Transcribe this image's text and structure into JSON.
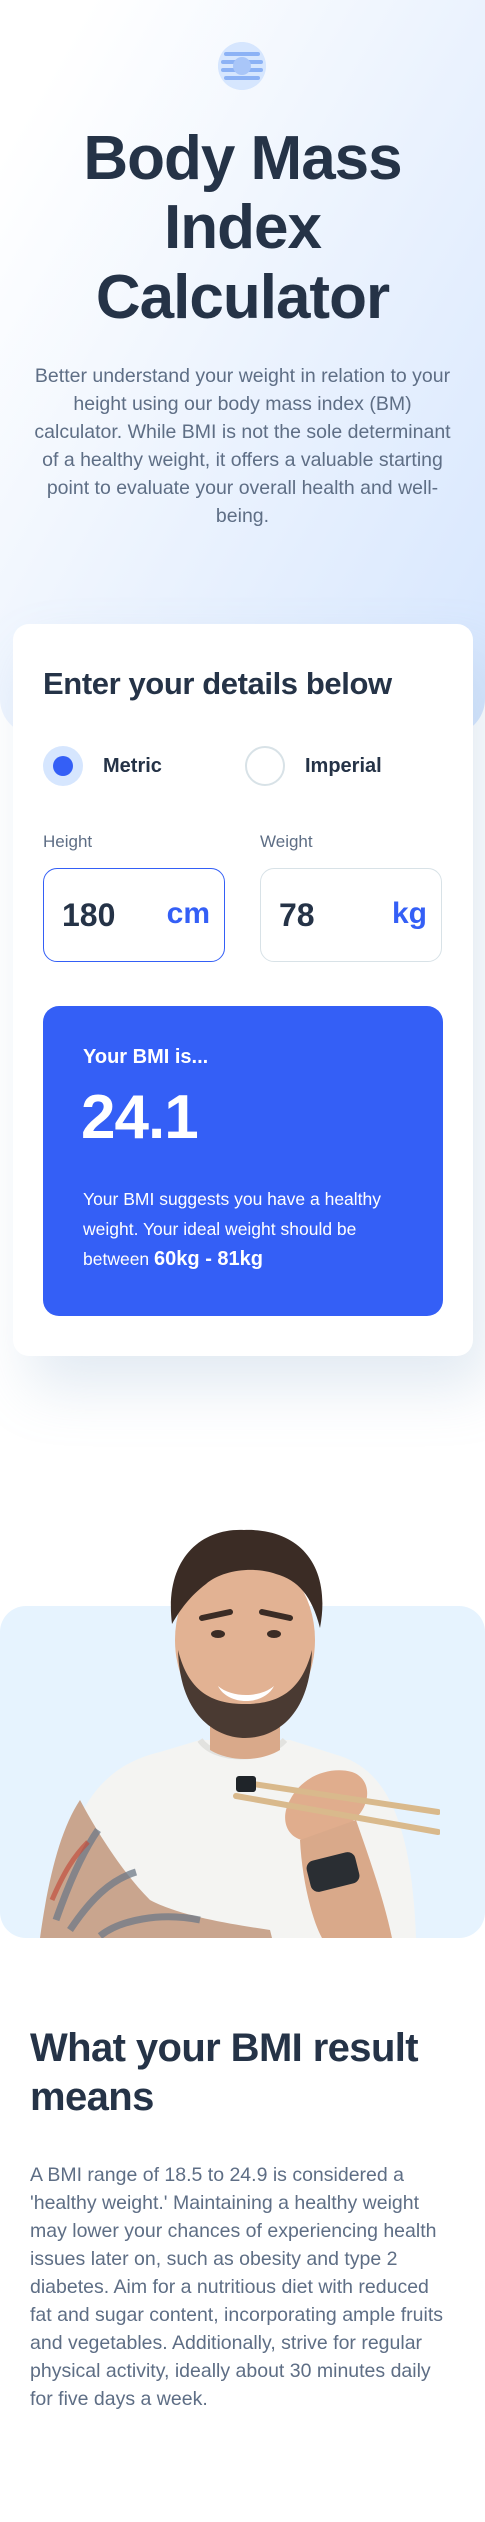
{
  "hero": {
    "logo_icon": "bmi-logo-icon",
    "title": "Body Mass Index Calculator",
    "intro": "Better understand your weight in relation to your height using our body mass index (BM) calculator. While BMI is not the sole determinant of a healthy weight, it offers a valuable starting point to evaluate your overall health and well-being."
  },
  "calculator": {
    "title": "Enter your details below",
    "units": [
      {
        "label": "Metric",
        "selected": true
      },
      {
        "label": "Imperial",
        "selected": false
      }
    ],
    "height": {
      "label": "Height",
      "value": "180",
      "unit": "cm"
    },
    "weight": {
      "label": "Weight",
      "value": "78",
      "unit": "kg"
    },
    "result": {
      "heading": "Your BMI is...",
      "value": "24.1",
      "text_prefix": "Your BMI suggests you have a healthy weight. Your ideal weight should be between",
      "range": "60kg - 81kg"
    }
  },
  "meaning": {
    "image": "man-eating-with-chopsticks-photo",
    "title": "What your BMI result means",
    "text": "A BMI range of 18.5 to 24.9 is considered a 'healthy weight.' Maintaining a healthy weight may lower your chances of experiencing health issues later on, such as obesity and type 2 diabetes. Aim for a nutritious diet with reduced fat and sugar content, incorporating ample fruits and vegetables. Additionally, strive for regular physical activity, ideally about 30 minutes daily for five days a week."
  },
  "colors": {
    "accent": "#345ff6",
    "text_dark": "#253347",
    "text_muted": "#5e6e85",
    "hero_gradient": "#d6e6fe",
    "photo_bg": "#e6f3fe"
  }
}
